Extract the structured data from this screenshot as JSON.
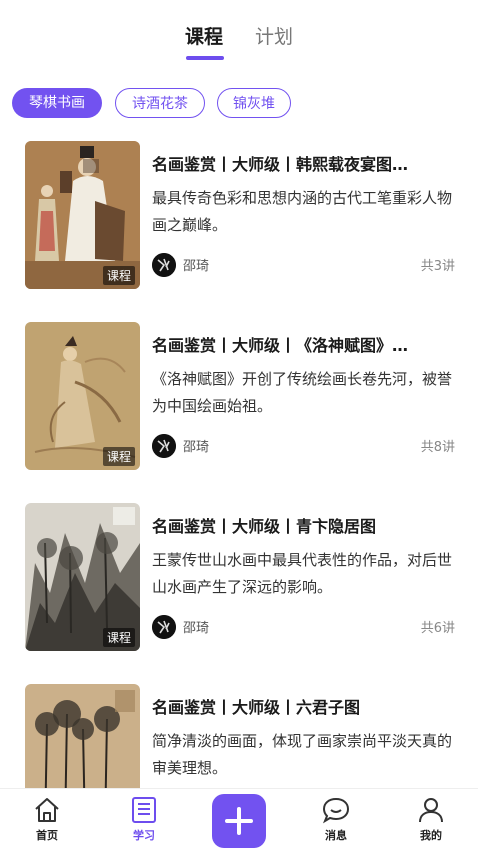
{
  "tabs": {
    "active": "课程",
    "inactive": "计划"
  },
  "chips": [
    "琴棋书画",
    "诗酒花茶",
    "锦灰堆"
  ],
  "courses": [
    {
      "title": "名画鉴赏丨大师级丨韩熙载夜宴图…",
      "desc": "最具传奇色彩和思想内涵的古代工笔重彩人物画之巅峰。",
      "tag": "课程",
      "author": "邵琦",
      "lessons": "共3讲"
    },
    {
      "title": "名画鉴赏丨大师级丨《洛神赋图》…",
      "desc": "《洛神赋图》开创了传统绘画长卷先河，被誉为中国绘画始祖。",
      "tag": "课程",
      "author": "邵琦",
      "lessons": "共8讲"
    },
    {
      "title": "名画鉴赏丨大师级丨青卞隐居图",
      "desc": "王蒙传世山水画中最具代表性的作品，对后世山水画产生了深远的影响。",
      "tag": "课程",
      "author": "邵琦",
      "lessons": "共6讲"
    },
    {
      "title": "名画鉴赏丨大师级丨六君子图",
      "desc": "简净清淡的画面，体现了画家崇尚平淡天真的审美理想。"
    }
  ],
  "nav": {
    "home": "首页",
    "study": "学习",
    "messages": "消息",
    "mine": "我的"
  },
  "colors": {
    "accent": "#7252f0"
  }
}
